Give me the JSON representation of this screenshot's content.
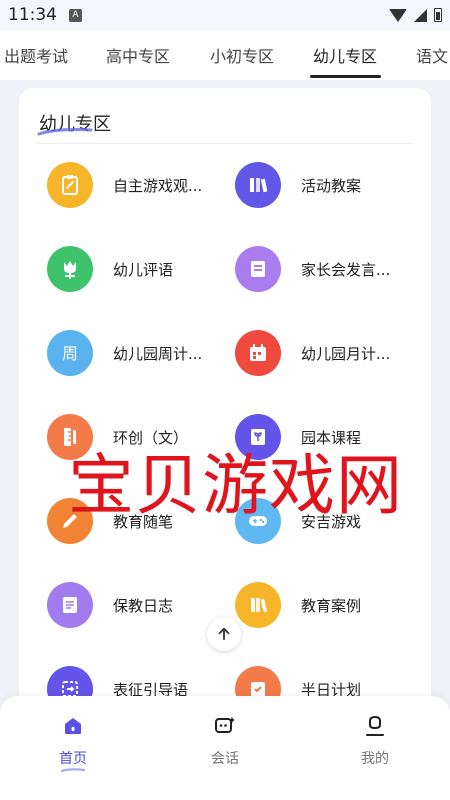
{
  "status_bar": {
    "time": "11:34",
    "notification_letter": "A"
  },
  "tabs": [
    {
      "label": "出题考试",
      "active": false
    },
    {
      "label": "高中专区",
      "active": false
    },
    {
      "label": "小初专区",
      "active": false
    },
    {
      "label": "幼儿专区",
      "active": true
    },
    {
      "label": "语文",
      "active": false
    }
  ],
  "section": {
    "title": "幼儿专区"
  },
  "items": [
    {
      "label": "自主游戏观...",
      "icon": "clipboard-icon",
      "color": "#f7b62a"
    },
    {
      "label": "活动教案",
      "icon": "books-icon",
      "color": "#6158e8"
    },
    {
      "label": "幼儿评语",
      "icon": "flower-icon",
      "color": "#3fc26c"
    },
    {
      "label": "家长会发言...",
      "icon": "inbox-icon",
      "color": "#a97cf0"
    },
    {
      "label": "幼儿园周计...",
      "icon": "week-icon",
      "color": "#5ab2ee"
    },
    {
      "label": "幼儿园月计...",
      "icon": "calendar-icon",
      "color": "#f04a3f"
    },
    {
      "label": "环创（文）",
      "icon": "ruler-icon",
      "color": "#f27b49"
    },
    {
      "label": "园本课程",
      "icon": "sprout-book-icon",
      "color": "#6454ea"
    },
    {
      "label": "教育随笔",
      "icon": "pencil-icon",
      "color": "#f28335"
    },
    {
      "label": "安吉游戏",
      "icon": "gamepad-icon",
      "color": "#5fb8f2"
    },
    {
      "label": "保教日志",
      "icon": "notepad-icon",
      "color": "#a17cef"
    },
    {
      "label": "教育案例",
      "icon": "bookshelf-icon",
      "color": "#f7b62a"
    },
    {
      "label": "表征引导语",
      "icon": "arrow-box-icon",
      "color": "#6454ea"
    },
    {
      "label": "半日计划",
      "icon": "checklist-icon",
      "color": "#f27b49"
    }
  ],
  "watermark": "宝贝游戏网",
  "bottom_nav": [
    {
      "label": "首页",
      "icon": "home-icon",
      "active": true
    },
    {
      "label": "会话",
      "icon": "chat-icon",
      "active": false
    },
    {
      "label": "我的",
      "icon": "user-icon",
      "active": false
    }
  ],
  "colors": {
    "accent": "#4c4ce0",
    "watermark": "#e0141c"
  }
}
